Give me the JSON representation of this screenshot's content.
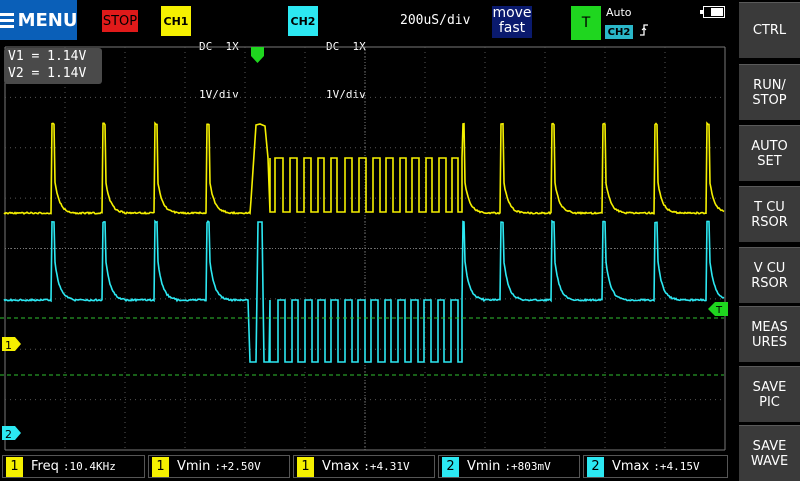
{
  "top_bar": {
    "menu_label": "MENU",
    "run_state": "STOP",
    "ch1": {
      "badge": "CH1",
      "line1": "DC  1X",
      "line2": "1V/div",
      "color": "#f5f000"
    },
    "ch2": {
      "badge": "CH2",
      "line1": "DC  1X",
      "line2": "1V/div",
      "color": "#2ce8f2"
    },
    "timebase": "200uS/div",
    "mode_line1": "move",
    "mode_line2": "fast",
    "trigger_badge": "T",
    "trigger_mode": "Auto",
    "trigger_source": "CH2",
    "trigger_edge_icon": "rising-edge-icon",
    "battery_icon": "battery-icon"
  },
  "cursor_readout": {
    "v1": "V1 = 1.14V",
    "v2": "V2 = 1.14V"
  },
  "markers": {
    "ch1": "1",
    "ch2": "2",
    "trigger": "T"
  },
  "side_buttons": [
    {
      "label": "CTRL"
    },
    {
      "label": "RUN/\nSTOP"
    },
    {
      "label": "AUTO\nSET"
    },
    {
      "label": "T CU\nRSOR"
    },
    {
      "label": "V CU\nRSOR"
    },
    {
      "label": "MEAS\nURES"
    },
    {
      "label": "SAVE\nPIC"
    },
    {
      "label": "SAVE\nWAVE"
    }
  ],
  "measurements": [
    {
      "ch": "1",
      "label": "Freq",
      "value": ":10.4KHz"
    },
    {
      "ch": "1",
      "label": "Vmin",
      "value": ":+2.50V"
    },
    {
      "ch": "1",
      "label": "Vmax",
      "value": ":+4.31V"
    },
    {
      "ch": "2",
      "label": "Vmin",
      "value": ":+803mV"
    },
    {
      "ch": "2",
      "label": "Vmax",
      "value": ":+4.15V"
    }
  ],
  "colors": {
    "ch1": "#f5f000",
    "ch2": "#2ce8f2",
    "trigger": "#1fd61f",
    "stop": "#e01a1a",
    "menu": "#0a5fb8"
  }
}
